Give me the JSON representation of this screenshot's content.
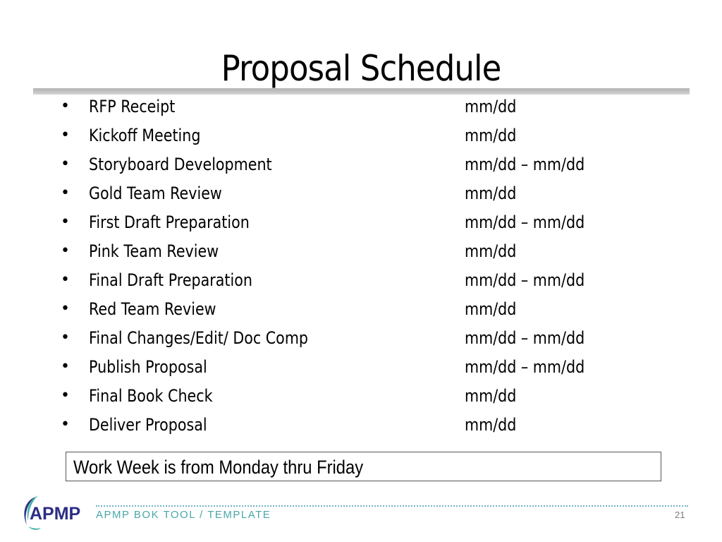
{
  "slide": {
    "title": "Proposal Schedule",
    "items": [
      {
        "task": "RFP Receipt",
        "date": "mm/dd"
      },
      {
        "task": "Kickoff Meeting",
        "date": "mm/dd"
      },
      {
        "task": "Storyboard Development",
        "date": "mm/dd – mm/dd"
      },
      {
        "task": "Gold Team Review",
        "date": "mm/dd"
      },
      {
        "task": "First Draft Preparation",
        "date": "mm/dd – mm/dd"
      },
      {
        "task": "Pink Team Review",
        "date": "mm/dd"
      },
      {
        "task": "Final Draft Preparation",
        "date": "mm/dd – mm/dd"
      },
      {
        "task": "Red Team Review",
        "date": "mm/dd"
      },
      {
        "task": "Final Changes/Edit/ Doc Comp",
        "date": "mm/dd – mm/dd"
      },
      {
        "task": "Publish Proposal",
        "date": "mm/dd – mm/dd"
      },
      {
        "task": "Final Book Check",
        "date": "mm/dd"
      },
      {
        "task": "Deliver Proposal",
        "date": "mm/dd"
      }
    ],
    "bullet": "•",
    "note": "Work Week is from Monday thru Friday"
  },
  "footer": {
    "logo_text": "APMP",
    "template_label": "APMP BOK TOOL / TEMPLATE",
    "page_number": "21"
  },
  "colors": {
    "logo_navy": "#2b2e83",
    "logo_teal": "#3fb3a6",
    "footer_text": "#4aa6a8"
  }
}
